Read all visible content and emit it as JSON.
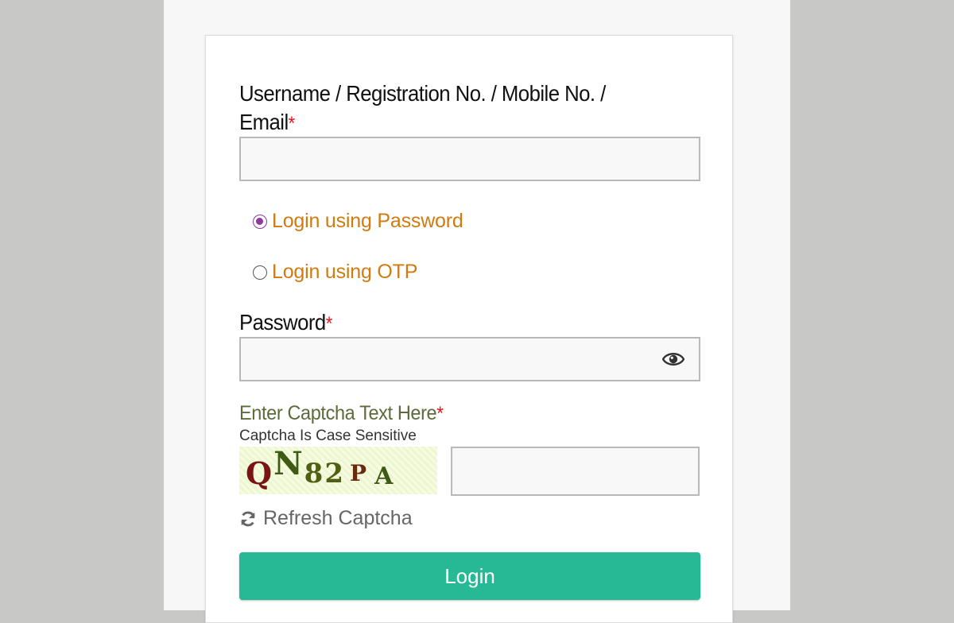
{
  "form": {
    "username_label": "Username / Registration No. / Mobile No. /",
    "username_label_line2": "Email",
    "required_mark": "*",
    "username_value": "",
    "login_options": [
      {
        "label": "Login using Password",
        "checked": true
      },
      {
        "label": "Login using OTP",
        "checked": false
      }
    ],
    "password_label": "Password",
    "password_value": "",
    "captcha_label": "Enter Captcha Text Here",
    "captcha_hint": "Captcha Is Case Sensitive",
    "captcha_characters": [
      "Q",
      "N",
      "8",
      "2",
      "P",
      "A"
    ],
    "captcha_value": "",
    "refresh_label": "Refresh Captcha",
    "login_button": "Login"
  },
  "colors": {
    "accent_green": "#27b995",
    "radio_purple": "#8e3a9d",
    "option_orange": "#d07a12",
    "captcha_label_olive": "#5b6b3a",
    "required_red": "#e8131a"
  },
  "icons": {
    "password_toggle": "eye-icon",
    "refresh": "refresh-icon"
  }
}
